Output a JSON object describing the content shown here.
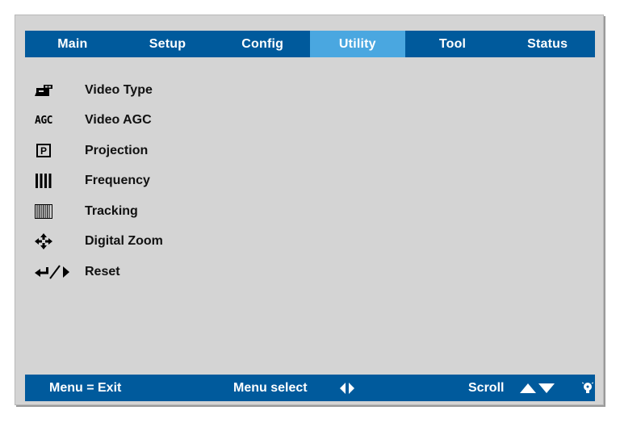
{
  "tabs": [
    {
      "label": "Main"
    },
    {
      "label": "Setup"
    },
    {
      "label": "Config"
    },
    {
      "label": "Utility",
      "active": true
    },
    {
      "label": "Tool"
    },
    {
      "label": "Status"
    }
  ],
  "menu": {
    "items": [
      {
        "icon": "video-camera-icon",
        "label": "Video Type"
      },
      {
        "icon": "agc-icon",
        "icon_text": "AGC",
        "label": "Video AGC"
      },
      {
        "icon": "projection-icon",
        "icon_text": "P",
        "label": "Projection"
      },
      {
        "icon": "frequency-bars-icon",
        "label": "Frequency"
      },
      {
        "icon": "tracking-lines-icon",
        "label": "Tracking"
      },
      {
        "icon": "move-arrows-icon",
        "label": "Digital Zoom"
      },
      {
        "icon": "enter-right-icon",
        "label": "Reset"
      }
    ]
  },
  "status": {
    "exit": "Menu = Exit",
    "select": "Menu select",
    "scroll": "Scroll"
  },
  "colors": {
    "bar": "#005a9c",
    "active_tab": "#4aa7e0",
    "panel": "#d4d4d4"
  }
}
